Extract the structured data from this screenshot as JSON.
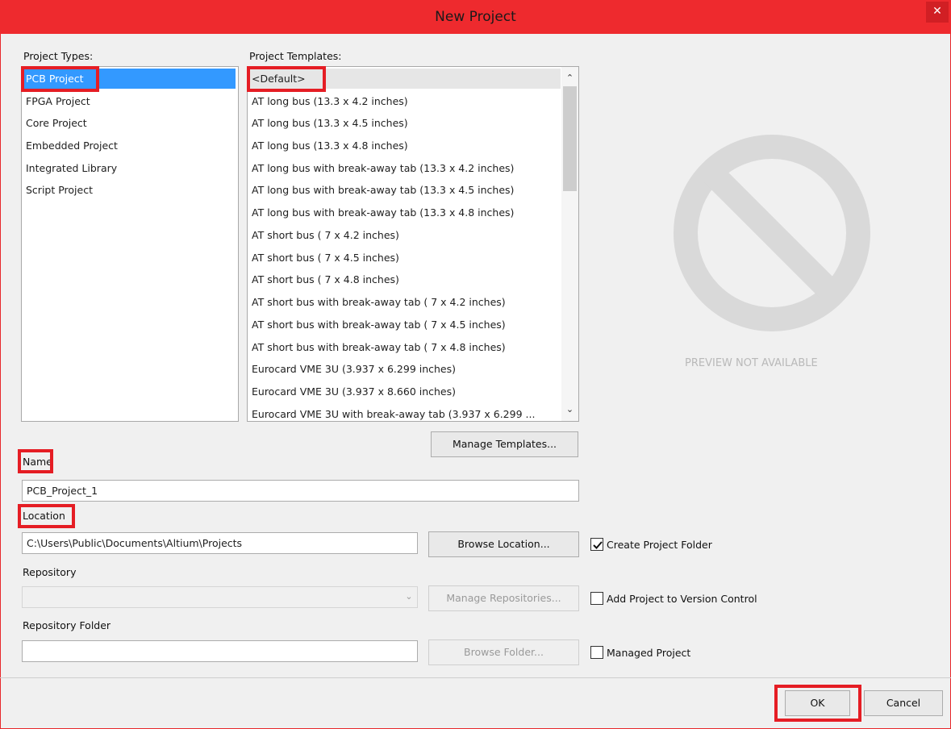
{
  "window": {
    "title": "New Project",
    "close": "✕"
  },
  "project_types": {
    "label": "Project Types:",
    "items": [
      "PCB Project",
      "FPGA Project",
      "Core Project",
      "Embedded Project",
      "Integrated Library",
      "Script Project"
    ],
    "selected": "PCB Project"
  },
  "project_templates": {
    "label": "Project Templates:",
    "items": [
      "<Default>",
      "AT long bus (13.3 x 4.2 inches)",
      "AT long bus (13.3 x 4.5 inches)",
      "AT long bus (13.3 x 4.8 inches)",
      "AT long bus with break-away tab (13.3 x 4.2 inches)",
      "AT long bus with break-away tab (13.3 x 4.5 inches)",
      "AT long bus with break-away tab (13.3 x 4.8 inches)",
      "AT short bus ( 7 x 4.2 inches)",
      "AT short bus ( 7 x 4.5 inches)",
      "AT short bus ( 7 x 4.8 inches)",
      "AT short bus with break-away tab ( 7 x 4.2 inches)",
      "AT short bus with break-away tab ( 7 x 4.5 inches)",
      "AT short bus with break-away tab ( 7 x 4.8 inches)",
      "Eurocard VME 3U (3.937 x 6.299 inches)",
      "Eurocard VME 3U (3.937 x 8.660 inches)",
      "Eurocard VME 3U with break-away tab (3.937 x 6.299 ..."
    ],
    "selected": "<Default>",
    "scroll_up": "⌃",
    "scroll_down": "⌄",
    "manage_button": "Manage Templates..."
  },
  "preview": {
    "text": "PREVIEW NOT AVAILABLE",
    "icon": "prohibited-icon"
  },
  "name": {
    "label": "Name",
    "value": "PCB_Project_1"
  },
  "location": {
    "label": "Location",
    "value": "C:\\Users\\Public\\Documents\\Altium\\Projects",
    "browse_button": "Browse Location...",
    "create_folder": {
      "label": "Create Project Folder",
      "checked": true
    }
  },
  "repository": {
    "label": "Repository",
    "value": "",
    "dropdown_arrow": "⌄",
    "manage_button": "Manage Repositories...",
    "version_control": {
      "label": "Add Project to Version Control",
      "checked": false
    }
  },
  "repository_folder": {
    "label": "Repository Folder",
    "value": "",
    "browse_button": "Browse Folder...",
    "managed": {
      "label": "Managed Project",
      "checked": false
    }
  },
  "footer": {
    "ok": "OK",
    "cancel": "Cancel"
  },
  "colors": {
    "title_bar": "#ee2a2e",
    "highlight": "#e51d24",
    "selection": "#3399ff"
  }
}
